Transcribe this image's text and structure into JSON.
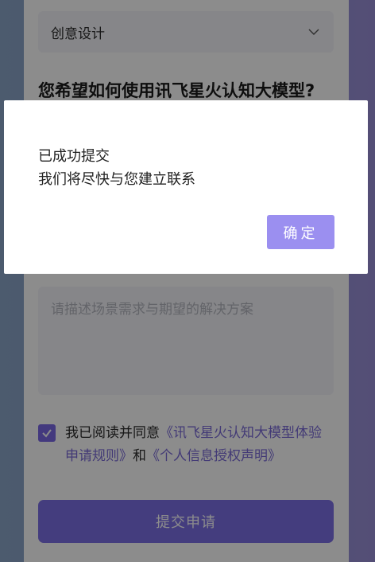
{
  "form": {
    "category_select_value": "创意设计",
    "question_title": "您希望如何使用讯飞星火认知大模型?",
    "scenario_textarea_placeholder": "请描述场景需求与期望的解决方案",
    "agreement": {
      "checked": true,
      "prefix": "我已阅读并同意",
      "link_rules": "《讯飞星火认知大模型体验申请规则》",
      "conjunction": "和",
      "link_privacy": "《个人信息授权声明》"
    },
    "submit_label": "提交申请"
  },
  "dialog": {
    "title": "已成功提交",
    "message": "我们将尽快与您建立联系",
    "confirm_label": "确定"
  },
  "icons": {
    "select": "chevron-down-icon",
    "checkbox": "checkmark-icon"
  },
  "colors": {
    "accent": "#7d6fe6",
    "confirm_button": "#9b8ff0",
    "link": "#7a6bd8"
  }
}
